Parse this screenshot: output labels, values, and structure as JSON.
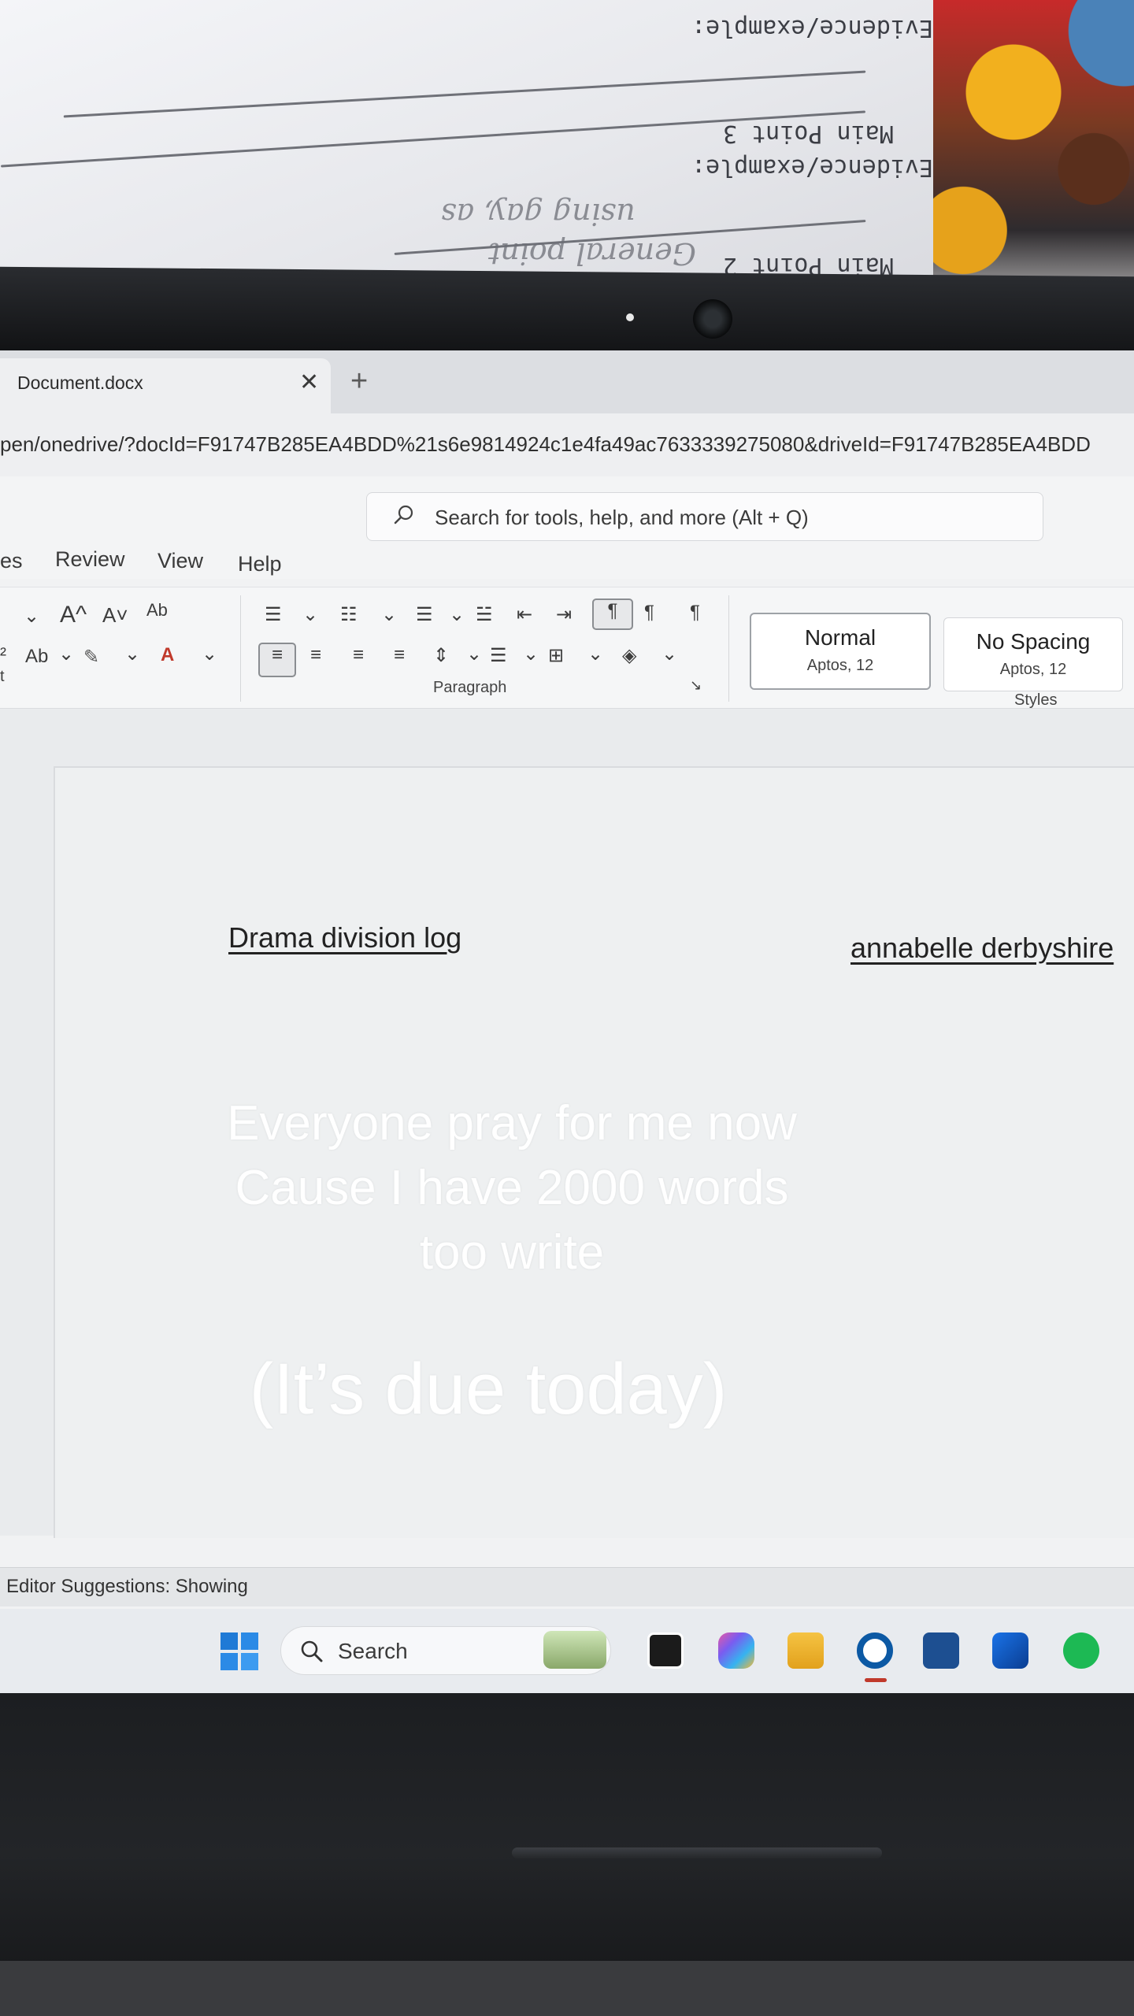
{
  "paper": {
    "line1": "Evidence/example:",
    "line2": "Main Point 3",
    "line3": "Evidence/example:",
    "line4": "Main Point 2",
    "handwriting1": "using gay, as",
    "handwriting2": "General point"
  },
  "browser": {
    "tab_title": "Document.docx",
    "tab_close": "✕",
    "new_tab": "+",
    "url": "pen/onedrive/?docId=F91747B285EA4BDD%21s6e9814924c1e4fa49ac7633339275080&driveId=F91747B285EA4BDD"
  },
  "search": {
    "placeholder": "Search for tools, help, and more (Alt + Q)"
  },
  "menu": {
    "item1": "es",
    "item2": "Review",
    "item3": "View",
    "item4": "Help"
  },
  "ribbon": {
    "font_grow": "A^",
    "font_shrink": "A˅",
    "clear_format": "Ab",
    "text_effects": "Ab",
    "left_label": "t",
    "paragraph_label": "Paragraph",
    "styles_label": "Styles",
    "style_normal": {
      "name": "Normal",
      "sub": "Aptos, 12"
    },
    "style_nospacing": {
      "name": "No Spacing",
      "sub": "Aptos, 12"
    }
  },
  "document": {
    "title": "Drama division log",
    "author": "annabelle derbyshire"
  },
  "status": {
    "text": "Editor Suggestions: Showing"
  },
  "taskbar": {
    "search_label": "Search"
  },
  "caption": {
    "line1": "Everyone pray for me now",
    "line2": "Cause I have 2000 words",
    "line3": "too write",
    "line4": "(It’s due today)"
  },
  "colors": {
    "edge_blue": "#0c59a4",
    "spotify_green": "#1db954",
    "font_red": "#c0392b"
  }
}
